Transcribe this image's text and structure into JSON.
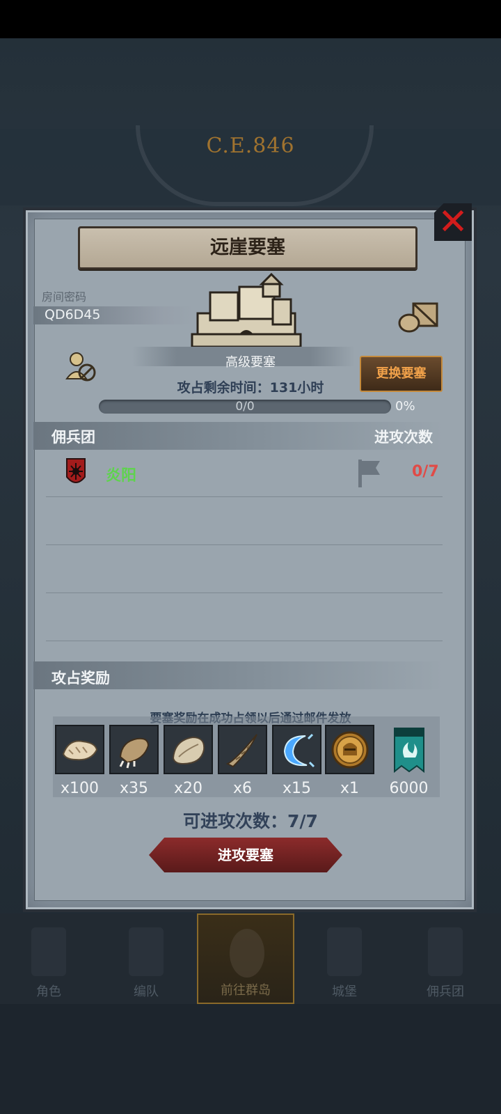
{
  "background": {
    "era": "C.E.846"
  },
  "dialog": {
    "title": "远崖要塞",
    "room_label": "房间密码",
    "room_code": "QD6D45",
    "fortress_level": "高级要塞",
    "change_button": "更换要塞",
    "time_label": "攻占剩余时间：131小时",
    "progress_text": "0/0",
    "progress_fraction": 0,
    "progress_percent": "0%",
    "mercenary_header": "佣兵团",
    "attack_count_header": "进攻次数",
    "mercenaries": [
      {
        "name": "炎阳",
        "attacks": "0/7"
      }
    ],
    "reward_header": "攻占奖励",
    "reward_note": "要塞奖励在成功占领以后通过邮件发放",
    "rewards": [
      {
        "icon": "fur-pelt-icon",
        "qty": "x100"
      },
      {
        "icon": "beast-claw-icon",
        "qty": "x35"
      },
      {
        "icon": "wool-pelt-icon",
        "qty": "x20"
      },
      {
        "icon": "horn-icon",
        "qty": "x6"
      },
      {
        "icon": "blue-crescent-icon",
        "qty": "x15"
      },
      {
        "icon": "knight-helmet-medal-icon",
        "qty": "x1"
      },
      {
        "icon": "teal-banner-icon",
        "qty": "6000"
      }
    ],
    "attack_remaining": "可进攻次数：7/7",
    "attack_button": "进攻要塞"
  },
  "nav": {
    "items": [
      {
        "label": "角色"
      },
      {
        "label": "编队"
      },
      {
        "label": "前往群岛"
      },
      {
        "label": "城堡"
      },
      {
        "label": "佣兵团"
      }
    ]
  },
  "colors": {
    "accent_red": "#e04b47",
    "mercenary_green": "#5fd34e",
    "close_red": "#d21c1c",
    "change_orange": "#f2a24a"
  }
}
